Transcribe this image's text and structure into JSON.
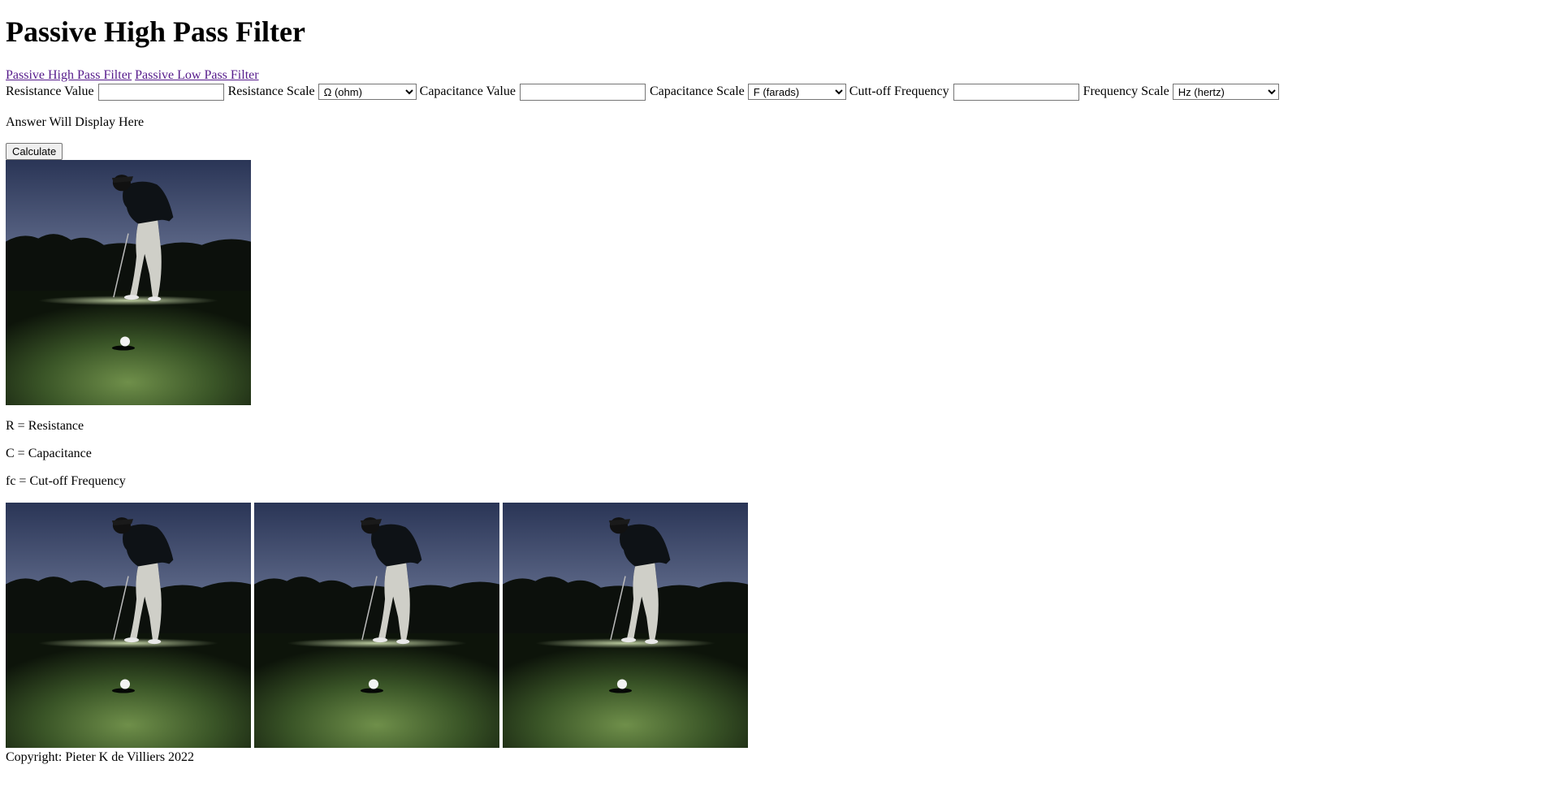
{
  "title": "Passive High Pass Filter",
  "nav": {
    "high_pass": "Passive High Pass Filter",
    "low_pass": "Passive Low Pass Filter"
  },
  "form": {
    "resistance_value_label": "Resistance Value",
    "resistance_value": "",
    "resistance_scale_label": "Resistance Scale",
    "resistance_scale_selected": "Ω (ohm)",
    "capacitance_value_label": "Capacitance Value",
    "capacitance_value": "",
    "capacitance_scale_label": "Capacitance Scale",
    "capacitance_scale_selected": "F (farads)",
    "cutoff_label": "Cutt-off Frequency",
    "cutoff_value": "",
    "frequency_scale_label": "Frequency Scale",
    "frequency_scale_selected": "Hz (hertz)"
  },
  "answer": "Answer Will Display Here",
  "calculate_label": "Calculate",
  "legend": {
    "r": "R = Resistance",
    "c": "C = Capacitance",
    "fc": "fc = Cut-off Frequency"
  },
  "copyright": "Copyright: Pieter K de Villiers 2022",
  "colors": {
    "link_visited": "#551a8b",
    "sky_top": "#3a4a6e",
    "sky_horizon": "#cfd2d6",
    "grass": "#3d5a2a"
  }
}
